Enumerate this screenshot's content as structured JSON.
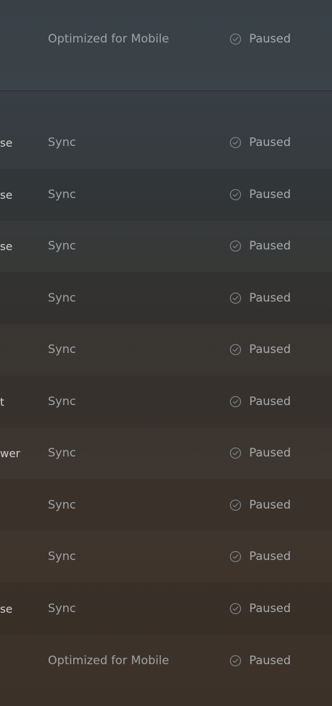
{
  "top_item": {
    "type": "Optimized for Mobile",
    "status": "Paused"
  },
  "items": [
    {
      "name_fragment": "se",
      "type": "Sync",
      "status": "Paused"
    },
    {
      "name_fragment": "se",
      "type": "Sync",
      "status": "Paused"
    },
    {
      "name_fragment": "se",
      "type": "Sync",
      "status": "Paused"
    },
    {
      "name_fragment": "",
      "type": "Sync",
      "status": "Paused"
    },
    {
      "name_fragment": "",
      "type": "Sync",
      "status": "Paused"
    },
    {
      "name_fragment": "t",
      "type": "Sync",
      "status": "Paused"
    },
    {
      "name_fragment": "wer",
      "type": "Sync",
      "status": "Paused"
    },
    {
      "name_fragment": "",
      "type": "Sync",
      "status": "Paused"
    },
    {
      "name_fragment": "",
      "type": "Sync",
      "status": "Paused"
    },
    {
      "name_fragment": "se",
      "type": "Sync",
      "status": "Paused"
    },
    {
      "name_fragment": "",
      "type": "Optimized for Mobile",
      "status": "Paused"
    }
  ],
  "icons": {
    "status": "check-circle-icon"
  },
  "colors": {
    "status_icon": "#7d8285",
    "type_text": "#9ea3a6",
    "status_text": "#a7abad",
    "name_text": "#d2d2d0"
  }
}
